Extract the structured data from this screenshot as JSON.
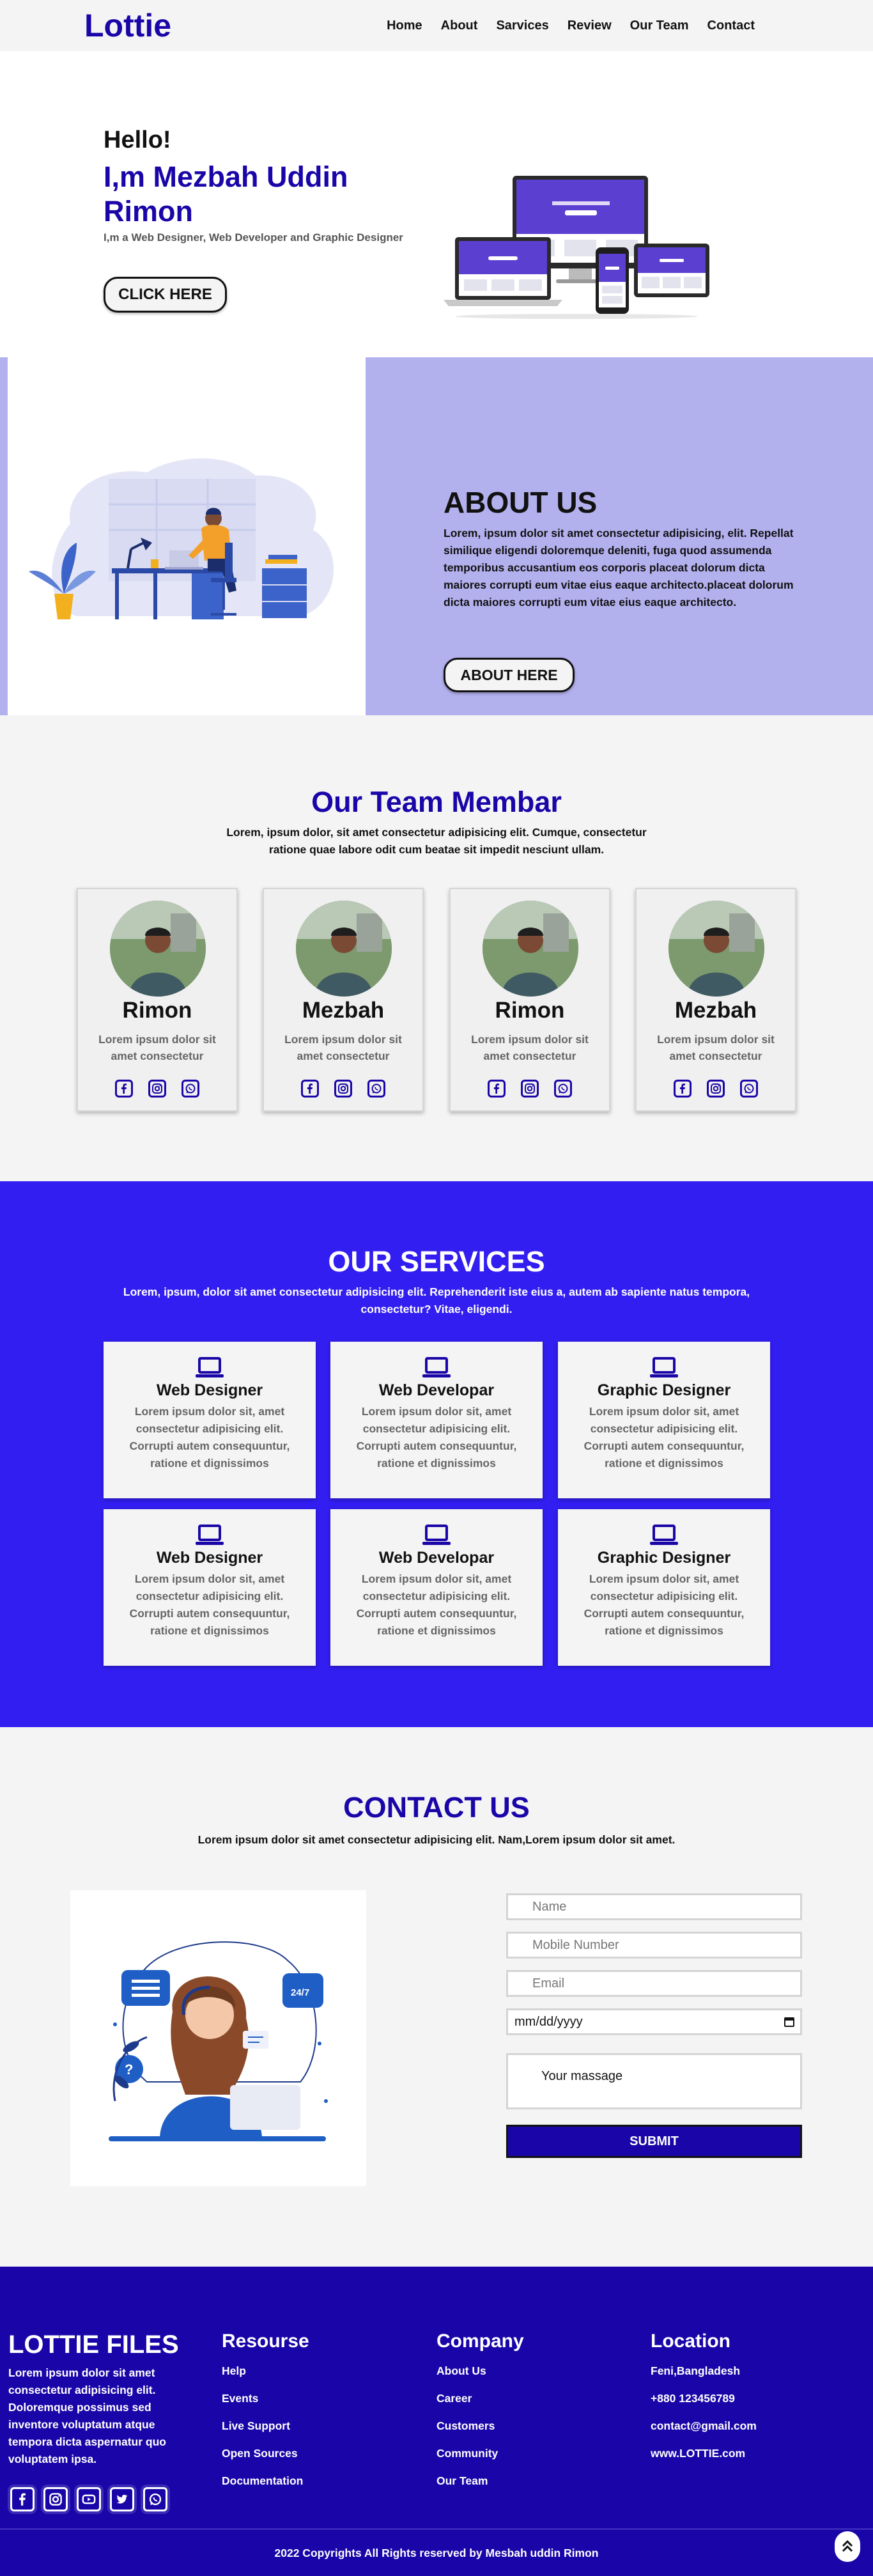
{
  "header": {
    "logo": "Lottie",
    "nav": [
      "Home",
      "About",
      "Sarvices",
      "Review",
      "Our Team",
      "Contact"
    ]
  },
  "hero": {
    "greeting": "Hello!",
    "name": "I,m Mezbah Uddin Rimon",
    "subtitle": "I,m a Web Designer, Web Developer and Graphic Designer",
    "button": "CLICK HERE"
  },
  "about": {
    "title": "ABOUT US",
    "text": "Lorem, ipsum dolor sit amet consectetur adipisicing, elit. Repellat similique eligendi doloremque deleniti, fuga quod assumenda temporibus accusantium eos corporis placeat dolorum dicta maiores corrupti eum vitae eius eaque architecto.placeat dolorum dicta maiores corrupti eum vitae eius eaque architecto.",
    "button": "ABOUT HERE"
  },
  "team": {
    "title": "Our Team Membar",
    "subtitle": "Lorem, ipsum dolor, sit amet consectetur adipisicing elit. Cumque, consectetur ratione quae labore odit cum beatae sit impedit nesciunt ullam.",
    "members": [
      {
        "name": "Rimon",
        "text": "Lorem ipsum dolor sit amet consectetur"
      },
      {
        "name": "Mezbah",
        "text": "Lorem ipsum dolor sit amet consectetur"
      },
      {
        "name": "Rimon",
        "text": "Lorem ipsum dolor sit amet consectetur"
      },
      {
        "name": "Mezbah",
        "text": "Lorem ipsum dolor sit amet consectetur"
      }
    ]
  },
  "services": {
    "title": "OUR SERVICES",
    "subtitle": "Lorem, ipsum, dolor sit amet consectetur adipisicing elit. Reprehenderit iste eius a, autem ab sapiente natus tempora, consectetur? Vitae, eligendi.",
    "items": [
      {
        "name": "Web Designer",
        "text": "Lorem ipsum dolor sit, amet consectetur adipisicing elit. Corrupti autem consequuntur, ratione et dignissimos"
      },
      {
        "name": "Web Developar",
        "text": "Lorem ipsum dolor sit, amet consectetur adipisicing elit. Corrupti autem consequuntur, ratione et dignissimos"
      },
      {
        "name": "Graphic Designer",
        "text": "Lorem ipsum dolor sit, amet consectetur adipisicing elit. Corrupti autem consequuntur, ratione et dignissimos"
      },
      {
        "name": "Web Designer",
        "text": "Lorem ipsum dolor sit, amet consectetur adipisicing elit. Corrupti autem consequuntur, ratione et dignissimos"
      },
      {
        "name": "Web Developar",
        "text": "Lorem ipsum dolor sit, amet consectetur adipisicing elit. Corrupti autem consequuntur, ratione et dignissimos"
      },
      {
        "name": "Graphic Designer",
        "text": "Lorem ipsum dolor sit, amet consectetur adipisicing elit. Corrupti autem consequuntur, ratione et dignissimos"
      }
    ]
  },
  "contact": {
    "title": "CONTACT US",
    "subtitle": "Lorem ipsum dolor sit amet consectetur adipisicing elit. Nam,Lorem ipsum dolor sit amet.",
    "name_placeholder": "Name",
    "mobile_placeholder": "Mobile Number",
    "email_placeholder": "Email",
    "date_placeholder": "mm/dd/yyyy",
    "message_placeholder": "Your massage",
    "submit": "SUBMIT"
  },
  "footer": {
    "brand": "LOTTIE FILES",
    "description": "Lorem ipsum dolor sit amet consectetur adipisicing elit. Doloremque possimus sed inventore voluptatum atque tempora dicta aspernatur quo voluptatem ipsa.",
    "resourse": {
      "title": "Resourse",
      "links": [
        "Help",
        "Events",
        "Live Support",
        "Open Sources",
        "Documentation"
      ]
    },
    "company": {
      "title": "Company",
      "links": [
        "About Us",
        "Career",
        "Customers",
        "Community",
        "Our Team"
      ]
    },
    "location": {
      "title": "Location",
      "lines": [
        "Feni,Bangladesh",
        "+880 123456789",
        "contact@gmail.com",
        "www.LOTTIE.com"
      ]
    },
    "copyright": "2022 Copyrights All Rights reserved by Mesbah uddin Rimon"
  },
  "colors": {
    "brand": "#1a06a8",
    "services_bg": "#321ef1",
    "about_bg": "#b3b0ee",
    "light_bg": "#f4f4f4"
  },
  "icons": [
    "facebook-icon",
    "instagram-icon",
    "youtube-icon",
    "twitter-icon",
    "whatsapp-icon",
    "laptop-icon",
    "chevron-up-icon"
  ]
}
